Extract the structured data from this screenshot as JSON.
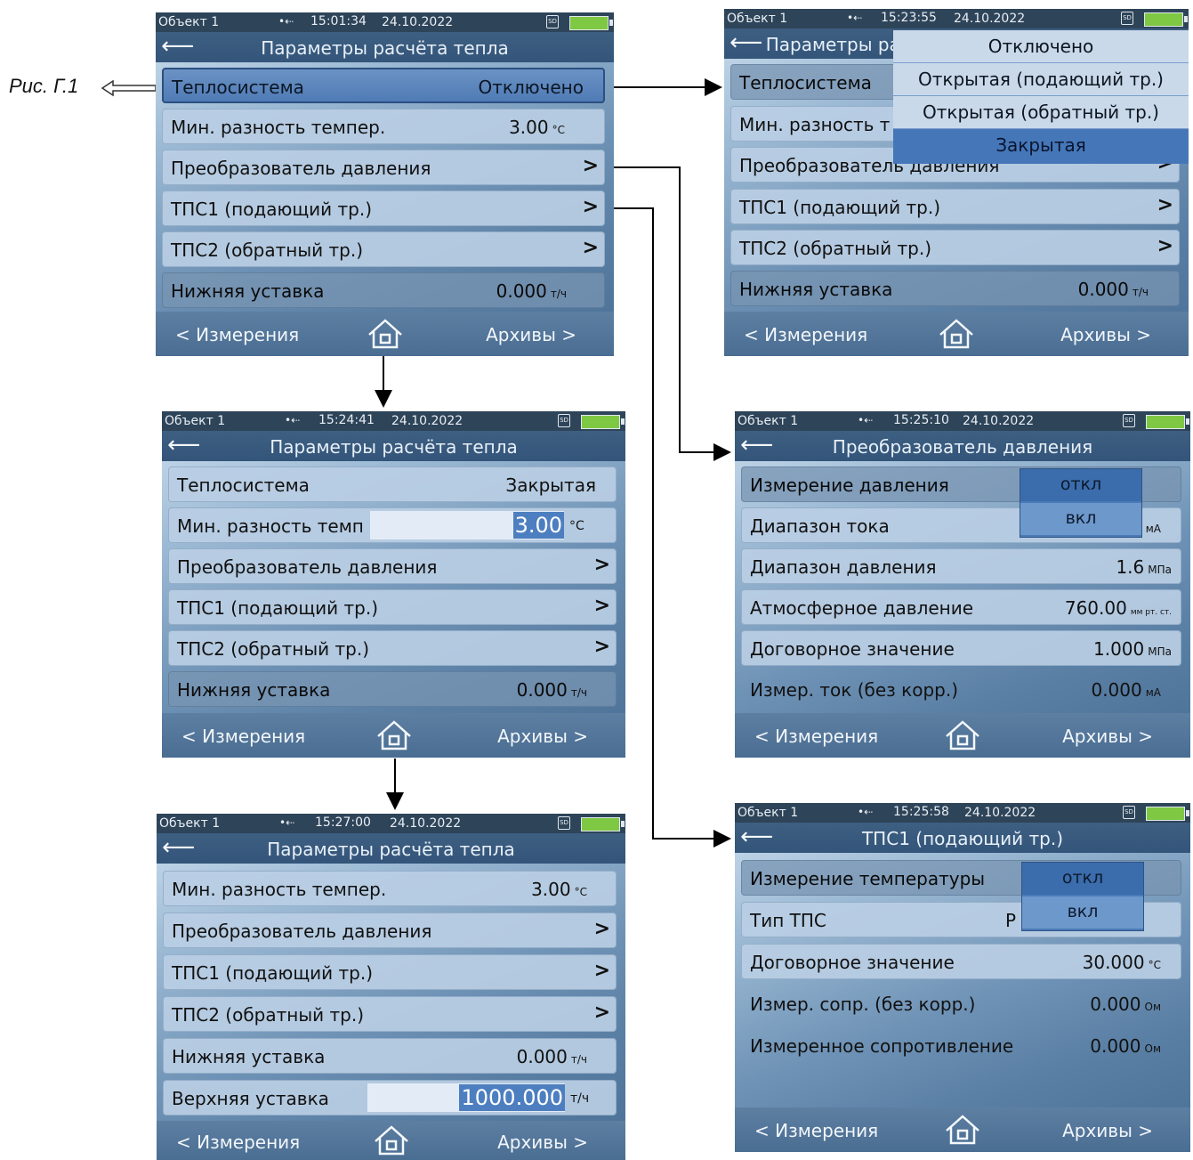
{
  "caption": "Рис. Г.1",
  "status": {
    "object": "Объект 1",
    "usb_icon": "usb-icon",
    "sd_label": "SD"
  },
  "nav": {
    "left": "< Измерения",
    "right": "Архивы >",
    "home_icon": "home-icon",
    "back_icon": "back-arrow-icon"
  },
  "screens": {
    "a": {
      "time": "15:01:34",
      "date": "24.10.2022",
      "title": "Параметры расчёта тепла",
      "rows": [
        {
          "label": "Теплосистема",
          "value": "Отключено"
        },
        {
          "label": "Мин. разность темпер.",
          "value": "3.00",
          "unit": "°C"
        },
        {
          "label": "Преобразователь давления"
        },
        {
          "label": "ТПС1 (подающий тр.)"
        },
        {
          "label": "ТПС2 (обратный тр.)"
        },
        {
          "label": "Нижняя уставка",
          "value": "0.000",
          "unit": "т/ч"
        }
      ]
    },
    "b": {
      "time": "15:23:55",
      "date": "24.10.2022",
      "title": "Параметры расчёта тепла",
      "rows": [
        {
          "label": "Теплосистема"
        },
        {
          "label": "Мин. разность т"
        },
        {
          "label": "Преобразователь давления"
        },
        {
          "label": "ТПС1 (подающий тр.)"
        },
        {
          "label": "ТПС2 (обратный тр.)"
        },
        {
          "label": "Нижняя уставка",
          "value": "0.000",
          "unit": "т/ч"
        }
      ],
      "dropdown": [
        "Отключено",
        "Открытая (подающий тр.)",
        "Открытая (обратный тр.)",
        "Закрытая"
      ]
    },
    "c": {
      "time": "15:24:41",
      "date": "24.10.2022",
      "title": "Параметры расчёта тепла",
      "rows": [
        {
          "label": "Теплосистема",
          "value": "Закрытая"
        },
        {
          "label": "Мин. разность темп",
          "edit": "3.00",
          "unit": "°C"
        },
        {
          "label": "Преобразователь давления"
        },
        {
          "label": "ТПС1 (подающий тр.)"
        },
        {
          "label": "ТПС2 (обратный тр.)"
        },
        {
          "label": "Нижняя уставка",
          "value": "0.000",
          "unit": "т/ч"
        }
      ]
    },
    "d": {
      "time": "15:25:10",
      "date": "24.10.2022",
      "title": "Преобразователь давления",
      "rows": [
        {
          "label": "Измерение давления"
        },
        {
          "label": "Диапазон тока",
          "unit": "мА"
        },
        {
          "label": "Диапазон давления",
          "value": "1.6",
          "unit": "МПа"
        },
        {
          "label": "Атмосферное давление",
          "value": "760.00",
          "unit": "мм рт. ст."
        },
        {
          "label": "Договорное значение",
          "value": "1.000",
          "unit": "МПа"
        },
        {
          "label": "Измер. ток (без корр.)",
          "value": "0.000",
          "unit": "мА"
        }
      ],
      "toggle": [
        "откл",
        "вкл"
      ]
    },
    "e": {
      "time": "15:27:00",
      "date": "24.10.2022",
      "title": "Параметры расчёта тепла",
      "rows": [
        {
          "label": "Мин. разность темпер.",
          "value": "3.00",
          "unit": "°C"
        },
        {
          "label": "Преобразователь давления"
        },
        {
          "label": "ТПС1 (подающий тр.)"
        },
        {
          "label": "ТПС2 (обратный тр.)"
        },
        {
          "label": "Нижняя уставка",
          "value": "0.000",
          "unit": "т/ч"
        },
        {
          "label": "Верхняя уставка",
          "edit": "1000.000",
          "unit": "т/ч"
        }
      ]
    },
    "f": {
      "time": "15:25:58",
      "date": "24.10.2022",
      "title": "ТПС1 (подающий тр.)",
      "rows": [
        {
          "label": "Измерение температуры"
        },
        {
          "label": "Тип ТПС",
          "value": "P"
        },
        {
          "label": "Договорное значение",
          "value": "30.000",
          "unit": "°C"
        },
        {
          "label": "Измер. сопр. (без корр.)",
          "value": "0.000",
          "unit": "Ом"
        },
        {
          "label": "Измеренное сопротивление",
          "value": "0.000",
          "unit": "Ом"
        }
      ],
      "toggle": [
        "откл",
        "вкл"
      ]
    }
  }
}
